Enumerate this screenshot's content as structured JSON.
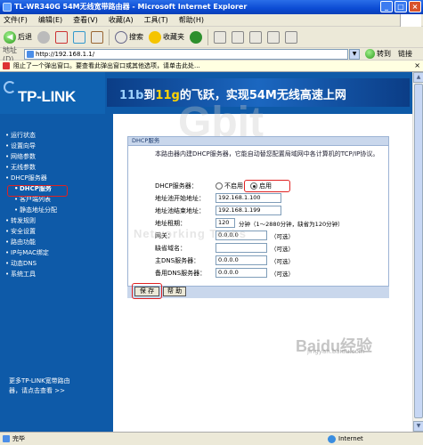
{
  "window": {
    "title": "TL-WR340G 54M无线宽带路由器 - Microsoft Internet Explorer",
    "buttons": [
      "_",
      "□",
      "×"
    ]
  },
  "menu": [
    "文件(F)",
    "编辑(E)",
    "查看(V)",
    "收藏(A)",
    "工具(T)",
    "帮助(H)"
  ],
  "toolbar": {
    "back": "后退",
    "search": "搜索",
    "favorites": "收藏夹"
  },
  "address": {
    "label": "地址(D)",
    "url": "http://192.168.1.1/",
    "go": "转到",
    "links": "链接"
  },
  "infobar": {
    "text": "阻止了一个弹出窗口。要查看此弹出窗口或其他选项，请单击此处..."
  },
  "banner": {
    "logo": "TP-LINK",
    "slogan_pre": "11b",
    "slogan_mid": "到",
    "slogan_11g": "11g",
    "slogan_post": "的飞跃，实现54M无线高速上网"
  },
  "sidebar": {
    "items": [
      {
        "label": "运行状态"
      },
      {
        "label": "设置向导"
      },
      {
        "label": "网络参数"
      },
      {
        "label": "无线参数"
      },
      {
        "label": "DHCP服务器"
      },
      {
        "label": "DHCP服务",
        "sub": true,
        "active": true
      },
      {
        "label": "客户端列表",
        "sub": true
      },
      {
        "label": "静态地址分配",
        "sub": true
      },
      {
        "label": "转发规则"
      },
      {
        "label": "安全设置"
      },
      {
        "label": "路由功能"
      },
      {
        "label": "IP与MAC绑定"
      },
      {
        "label": "动态DNS"
      },
      {
        "label": "系统工具"
      }
    ],
    "promo_line1": "更多TP-LINK宽带路由",
    "promo_line2": "器，请点击查看 >>"
  },
  "panel": {
    "title": "DHCP服务",
    "description": "本路由器内建DHCP服务器，它能自动替您配置局域网中各计算机的TCP/IP协议。",
    "dhcp_label": "DHCP服务器：",
    "radio_off": "不启用",
    "radio_on": "启用",
    "selected": "启用",
    "start_label": "地址池开始地址：",
    "start_value": "192.168.1.100",
    "end_label": "地址池结束地址：",
    "end_value": "192.168.1.199",
    "lease_label": "地址租期：",
    "lease_value": "120",
    "lease_hint": "分钟（1～2880分钟，缺省为120分钟）",
    "gateway_label": "网关：",
    "gateway_value": "0.0.0.0",
    "domain_label": "缺省域名：",
    "domain_value": "",
    "dns1_label": "主DNS服务器：",
    "dns1_value": "0.0.0.0",
    "dns2_label": "备用DNS服务器：",
    "dns2_value": "0.0.0.0",
    "optional": "（可选）",
    "save": "保 存",
    "help": "帮 助"
  },
  "watermarks": {
    "big": "Gbit",
    "mid": "Networking Techs",
    "baidu": "Baidu经验",
    "baidu_url": "jingyan.baidu.com"
  },
  "statusbar": {
    "done": "完毕",
    "zone": "Internet"
  }
}
